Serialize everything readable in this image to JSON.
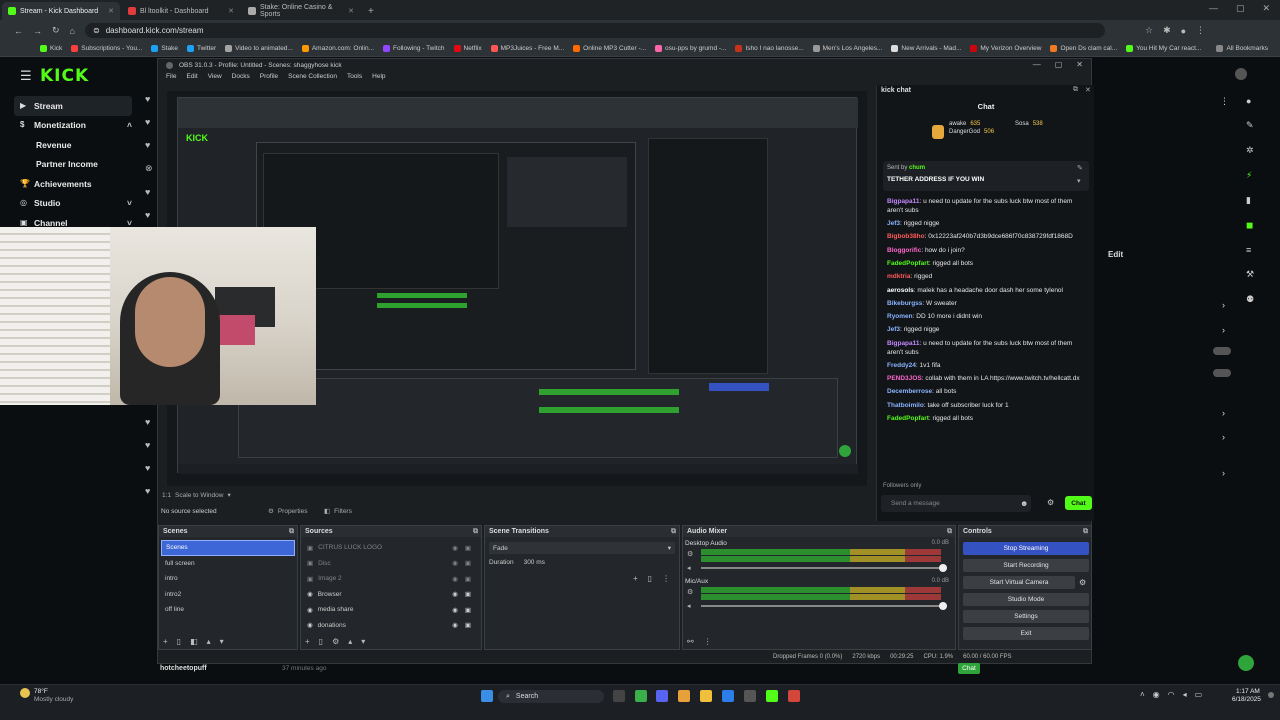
{
  "browser": {
    "tabs": [
      {
        "label": "Stream - Kick Dashboard",
        "color": "#53fc18",
        "active": true
      },
      {
        "label": "Bl ltoolkit - Dashboard",
        "color": "#e03c3c",
        "active": false
      },
      {
        "label": "Stake: Online Casino & Sports",
        "color": "#aaaaaa",
        "active": false
      }
    ],
    "url": "dashboard.kick.com/stream",
    "bookmarks": [
      "Kick",
      "Subscriptions - You...",
      "Stake",
      "Twitter",
      "Video to animated...",
      "Amazon.com: Onlin...",
      "Following - Twitch",
      "Netflix",
      "MP3Juices - Free M...",
      "Online MP3 Cutter -...",
      "osu-pps by grumd -...",
      "Isho I nao lanosse...",
      "Men's Los Angeles...",
      "New Arrivals - Mad...",
      "My Verizon Overview",
      "Open Ds clam cal...",
      "You Hit My Car react...",
      "All Bookmarks"
    ]
  },
  "kick": {
    "logo": "KICK",
    "sidebar": [
      {
        "label": "Stream",
        "active": true,
        "sub": false,
        "chevron": ""
      },
      {
        "label": "Monetization",
        "active": false,
        "sub": false,
        "chevron": "up"
      },
      {
        "label": "Revenue",
        "active": false,
        "sub": true,
        "chevron": ""
      },
      {
        "label": "Partner Income",
        "active": false,
        "sub": true,
        "chevron": ""
      },
      {
        "label": "Achievements",
        "active": false,
        "sub": false,
        "chevron": ""
      },
      {
        "label": "Studio",
        "active": false,
        "sub": false,
        "chevron": "down"
      },
      {
        "label": "Channel",
        "active": false,
        "sub": false,
        "chevron": "down"
      }
    ],
    "edit_label": "Edit",
    "bottom_user": "hotcheetopuff",
    "bottom_time": "37 minutes ago",
    "bottom_chat": "Chat"
  },
  "obs": {
    "title": "OBS 31.0.3 - Profile: Untitled - Scenes: shaggyhose kick",
    "menu": [
      "File",
      "Edit",
      "View",
      "Docks",
      "Profile",
      "Scene Collection",
      "Tools",
      "Help"
    ],
    "scale_label": "Scale to Window",
    "no_source": "No source selected",
    "properties": "Properties",
    "filters": "Filters",
    "scenes": {
      "title": "Scenes",
      "items": [
        "Scenes",
        "full screen",
        "intro",
        "intro2",
        "off line"
      ],
      "selected": 0
    },
    "sources": {
      "title": "Sources",
      "items": [
        "CITRUS LUCK LOGO",
        "Disc",
        "Image 2",
        "Browser",
        "media share",
        "donations"
      ]
    },
    "transitions": {
      "title": "Scene Transitions",
      "value": "Fade",
      "duration_label": "Duration",
      "duration_value": "300 ms"
    },
    "mixer": {
      "title": "Audio Mixer",
      "channels": [
        {
          "name": "Desktop Audio",
          "db": "0.0 dB"
        },
        {
          "name": "Mic/Aux",
          "db": "0.0 dB"
        }
      ]
    },
    "controls": {
      "title": "Controls",
      "buttons": [
        "Stop Streaming",
        "Start Recording",
        "Start Virtual Camera",
        "Studio Mode",
        "Settings",
        "Exit"
      ]
    },
    "status": {
      "dropped": "Dropped Frames 0 (0.0%)",
      "kbps": "2720 kbps",
      "time": "00:29:25",
      "cpu": "CPU: 1.9%",
      "fps": "60.00 / 60.00 FPS"
    }
  },
  "chat": {
    "window_title": "kick chat",
    "header": "Chat",
    "top_users": [
      {
        "name": "awake",
        "count": "635"
      },
      {
        "name": "Sosa",
        "count": "538"
      },
      {
        "name": "DangerGod",
        "count": "506"
      }
    ],
    "pinned_by": "Sent by",
    "pinned_user": "chum",
    "pinned_text": "TETHER ADDRESS IF YOU WIN",
    "messages": [
      {
        "user": "Bigpapa11",
        "text": "u need to update for the subs luck btw most of them aren't subs",
        "color": "#c488ff"
      },
      {
        "user": "Jef3",
        "text": "rigged nigge",
        "color": "#8ab4ff"
      },
      {
        "user": "Bigbob38ho",
        "text": "0x12223af240b7d3b9dce686f70c838729fdf1868D",
        "color": "#ff5a5a"
      },
      {
        "user": "Bloggorific",
        "text": "how do i join?",
        "color": "#ff66cc"
      },
      {
        "user": "FadedPopfart",
        "text": "rigged all bots",
        "color": "#53fc18"
      },
      {
        "user": "mdktria",
        "text": "rigged",
        "color": "#ff5a5a"
      },
      {
        "user": "aerosols",
        "text": "malek has a headache door dash her some tylenol",
        "color": "#ffffff"
      },
      {
        "user": "Bikeburgss",
        "text": "W sweater",
        "color": "#8ab4ff"
      },
      {
        "user": "Ryomen",
        "text": "DD 10 more i didnt win",
        "color": "#8ab4ff"
      },
      {
        "user": "Jef3",
        "text": "rigged nigge",
        "color": "#8ab4ff"
      },
      {
        "user": "Bigpapa11",
        "text": "u need to update for the subs luck btw most of them aren't subs",
        "color": "#c488ff"
      },
      {
        "user": "Freddy24",
        "text": "1v1 fifa",
        "color": "#8ab4ff"
      },
      {
        "user": "PEND3JOS",
        "text": "collab with them in LA https://www.twitch.tv/hellcatt.dx",
        "color": "#ff66cc"
      },
      {
        "user": "Decemberrose",
        "text": "all bots",
        "color": "#8ab4ff"
      },
      {
        "user": "Thatboimilo",
        "text": "take off subscriber luck for 1",
        "color": "#8ab4ff"
      },
      {
        "user": "FadedPopfart",
        "text": "rigged all bots",
        "color": "#53fc18"
      }
    ],
    "followers_only": "Followers only",
    "input_placeholder": "Send a message",
    "send_label": "Chat"
  },
  "taskbar": {
    "search": "Search",
    "weather_temp": "78°F",
    "weather_desc": "Mostly cloudy",
    "time": "1:17 AM",
    "date": "6/18/2025"
  }
}
